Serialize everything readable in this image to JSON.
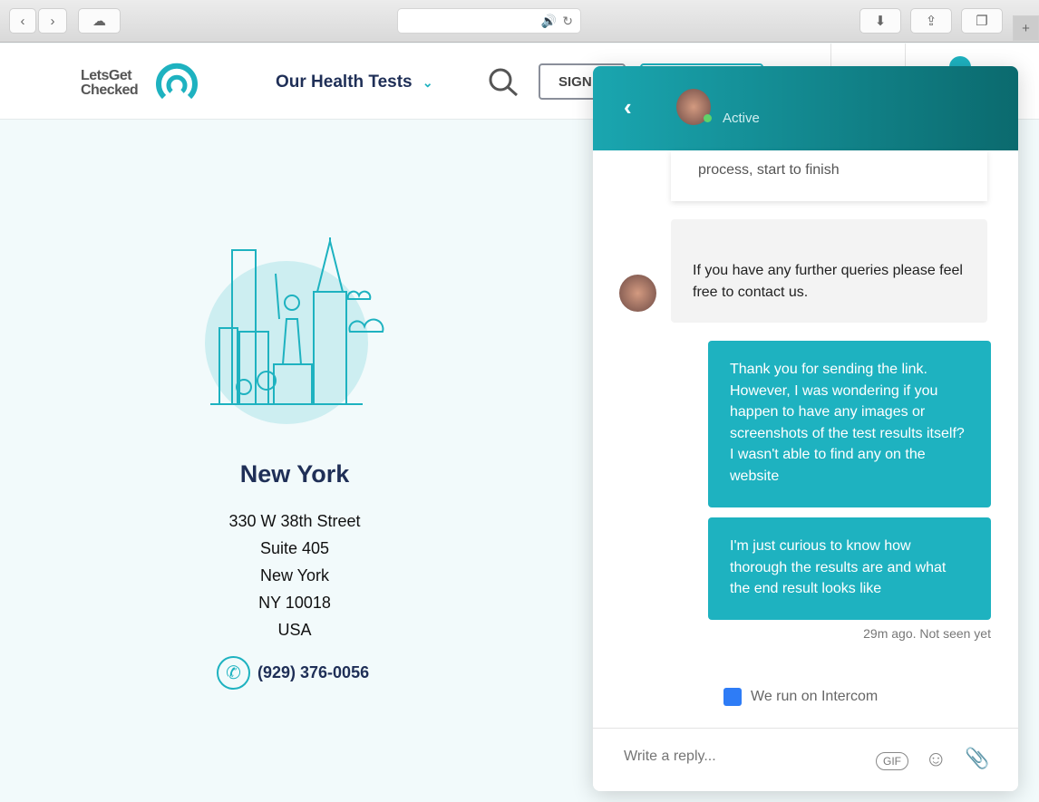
{
  "browser": {
    "back": "‹",
    "forward": "›",
    "add_tab": "+"
  },
  "header": {
    "logo_line1": "LetsGet",
    "logo_line2": "Checked",
    "nav_item": "Our Health Tests",
    "sign_button": "SIGN"
  },
  "location": {
    "city": "New York",
    "address": [
      "330 W 38th Street",
      "Suite 405",
      "New York",
      "NY 10018",
      "USA"
    ],
    "phone": "(929) 376-0056"
  },
  "chat": {
    "status": "Active",
    "article_text": "process, start to finish",
    "incoming": "If you have any further queries please feel free to contact us.",
    "outgoing": [
      "Thank you for sending the link. However, I was wondering if you happen to have any images or screenshots of the test results itself? I wasn't able to find any on the website",
      "I'm just curious to know how thorough the results are and what the end result looks like"
    ],
    "meta": "29m ago. Not seen yet",
    "powered_by": "We run on Intercom",
    "reply_placeholder": "Write a reply...",
    "gif_label": "GIF"
  },
  "colors": {
    "accent": "#1eb2c0",
    "header": "#0b6a6e",
    "nav": "#1f2f57"
  }
}
